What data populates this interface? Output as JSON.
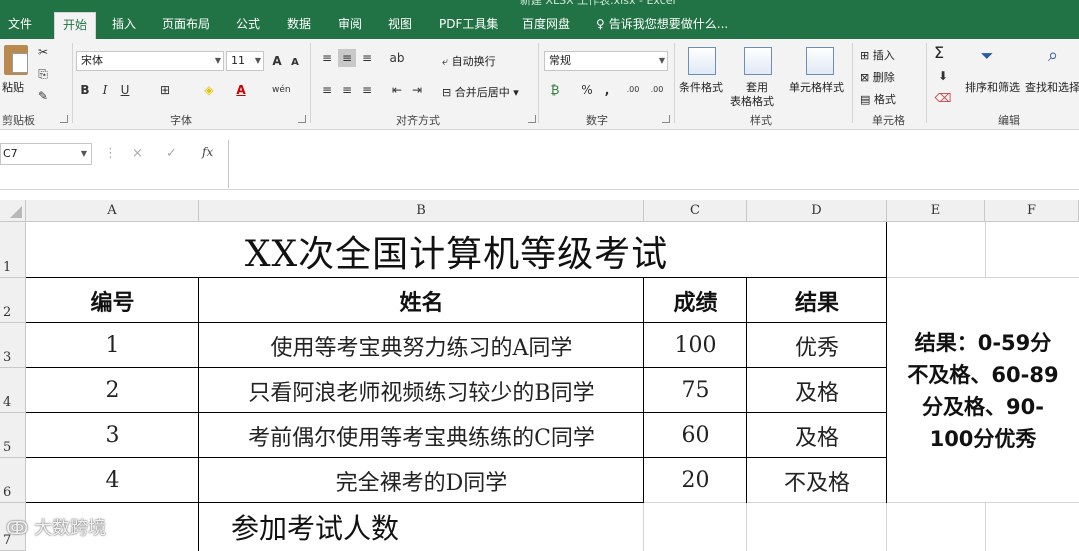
{
  "window": {
    "title": "新建 XLSX 工作表.xlsx - Excel"
  },
  "tabs": [
    {
      "label": "文件"
    },
    {
      "label": "开始"
    },
    {
      "label": "插入"
    },
    {
      "label": "页面布局"
    },
    {
      "label": "公式"
    },
    {
      "label": "数据"
    },
    {
      "label": "审阅"
    },
    {
      "label": "视图"
    },
    {
      "label": "PDF工具集"
    },
    {
      "label": "百度网盘"
    },
    {
      "label": "告诉我您想要做什么..."
    }
  ],
  "ribbon": {
    "clipboard": {
      "paste": "粘贴",
      "group": "剪贴板"
    },
    "font": {
      "name": "宋体",
      "size": "11",
      "bold": "B",
      "italic": "I",
      "underline": "U",
      "grow": "A",
      "shrink": "A",
      "pinyin": "wén",
      "fontcolor": "A",
      "group": "字体"
    },
    "alignment": {
      "wrap": "自动换行",
      "merge": "合并后居中",
      "group": "对齐方式"
    },
    "number": {
      "format": "常规",
      "percent": "%",
      "comma": ",",
      "inc": ".00",
      "dec": ".00",
      "group": "数字"
    },
    "styles": {
      "conditional": "条件格式",
      "table1": "套用",
      "table2": "表格格式",
      "cell_styles": "单元格样式",
      "group": "样式"
    },
    "cells": {
      "insert": "插入",
      "delete": "删除",
      "format": "格式",
      "group": "单元格"
    },
    "editing": {
      "sum": "Σ",
      "sort": "排序和筛选",
      "find": "查找和选择",
      "group": "编辑"
    }
  },
  "formula_bar": {
    "name_box": "C7",
    "cancel": "×",
    "enter": "✓",
    "fx": "fx",
    "value": ""
  },
  "grid": {
    "columns": [
      "A",
      "B",
      "C",
      "D",
      "E",
      "F"
    ],
    "rows": [
      "1",
      "2",
      "3",
      "4",
      "5",
      "6",
      "7"
    ],
    "title": "XX次全国计算机等级考试",
    "headers": {
      "id": "编号",
      "name": "姓名",
      "score": "成绩",
      "result": "结果"
    },
    "records": [
      {
        "id": "1",
        "name": "使用等考宝典努力练习的A同学",
        "score": "100",
        "result": "优秀"
      },
      {
        "id": "2",
        "name": "只看阿浪老师视频练习较少的B同学",
        "score": "75",
        "result": "及格"
      },
      {
        "id": "3",
        "name": "考前偶尔使用等考宝典练练的C同学",
        "score": "60",
        "result": "及格"
      },
      {
        "id": "4",
        "name": "完全裸考的D同学",
        "score": "20",
        "result": "不及格"
      }
    ],
    "count_label": "参加考试人数",
    "note_lines": [
      "结果：0-59分",
      "不及格、60-89",
      "分及格、90-",
      "100分优秀"
    ]
  },
  "watermark": "大数跨境"
}
